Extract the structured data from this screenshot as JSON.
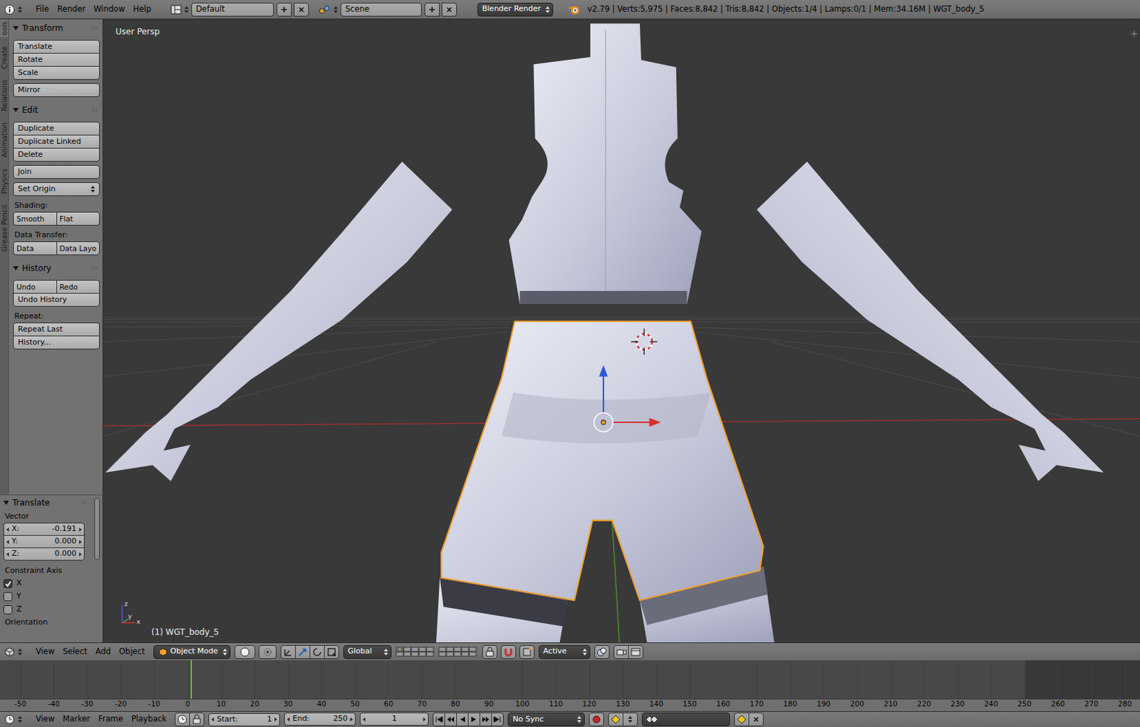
{
  "topbar": {
    "menus": [
      "File",
      "Render",
      "Window",
      "Help"
    ],
    "layout": "Default",
    "scene": "Scene",
    "engine": "Blender Render",
    "stats": "v2.79 | Verts:5,975 | Faces:8,842 | Tris:8,842 | Objects:1/4 | Lamps:0/1 | Mem:34.16M | WGT_body_5"
  },
  "tool_tabs": [
    {
      "label": "ools",
      "selected": true
    },
    {
      "label": "Create",
      "selected": false
    },
    {
      "label": "Relations",
      "selected": false
    },
    {
      "label": "Animation",
      "selected": false
    },
    {
      "label": "Physics",
      "selected": false
    },
    {
      "label": "Grease Pencil",
      "selected": false
    }
  ],
  "tool_panels": [
    {
      "title": "Transform",
      "expanded": true,
      "groups": [
        [
          {
            "kind": "button",
            "labels": [
              "Translate"
            ]
          },
          {
            "kind": "button",
            "labels": [
              "Rotate"
            ]
          },
          {
            "kind": "button",
            "labels": [
              "Scale"
            ]
          }
        ],
        [
          {
            "kind": "button",
            "labels": [
              "Mirror"
            ]
          }
        ]
      ]
    },
    {
      "title": "Edit",
      "expanded": true,
      "groups": [
        [
          {
            "kind": "button",
            "labels": [
              "Duplicate"
            ]
          },
          {
            "kind": "button",
            "labels": [
              "Duplicate Linked"
            ]
          },
          {
            "kind": "button",
            "labels": [
              "Delete"
            ]
          }
        ],
        [
          {
            "kind": "button",
            "labels": [
              "Join"
            ]
          }
        ],
        [
          {
            "kind": "menu",
            "labels": [
              "Set Origin"
            ]
          }
        ],
        [
          {
            "kind": "label",
            "labels": [
              "Shading:"
            ]
          },
          {
            "kind": "pair",
            "labels": [
              "Smooth",
              "Flat"
            ]
          }
        ],
        [
          {
            "kind": "label",
            "labels": [
              "Data Transfer:"
            ]
          },
          {
            "kind": "pair",
            "labels": [
              "Data",
              "Data Layo"
            ]
          }
        ]
      ]
    },
    {
      "title": "History",
      "expanded": true,
      "groups": [
        [
          {
            "kind": "pair",
            "labels": [
              "Undo",
              "Redo"
            ]
          },
          {
            "kind": "button",
            "labels": [
              "Undo History"
            ]
          }
        ],
        [
          {
            "kind": "label",
            "labels": [
              "Repeat:"
            ]
          },
          {
            "kind": "button",
            "labels": [
              "Repeat Last"
            ]
          },
          {
            "kind": "button",
            "labels": [
              "History..."
            ]
          }
        ]
      ]
    }
  ],
  "operator_panel": {
    "title": "Translate",
    "expanded": true,
    "vector_label": "Vector",
    "fields": [
      {
        "label": "X:",
        "value": "-0.191"
      },
      {
        "label": "Y:",
        "value": "0.000"
      },
      {
        "label": "Z:",
        "value": "0.000"
      }
    ],
    "constraint_label": "Constraint Axis",
    "axes": [
      {
        "label": "X",
        "checked": true
      },
      {
        "label": "Y",
        "checked": false
      },
      {
        "label": "Z",
        "checked": false
      }
    ],
    "next_label": "Orientation"
  },
  "viewport": {
    "view_label": "User Persp",
    "object_label": "(1) WGT_body_5",
    "gizmo_labels": [
      "z",
      "y",
      "x"
    ],
    "meshes": [
      {
        "kind": "torso",
        "selected": false
      },
      {
        "kind": "left-arm",
        "selected": false
      },
      {
        "kind": "right-arm",
        "selected": false
      },
      {
        "kind": "legs",
        "selected": false
      },
      {
        "kind": "hips",
        "selected": true
      }
    ]
  },
  "view_header": {
    "menus": [
      "View",
      "Select",
      "Add",
      "Object"
    ],
    "mode": "Object Mode",
    "orientation": "Global",
    "pivot": "Active"
  },
  "timeline": {
    "ticks": [
      "-50",
      "-40",
      "-30",
      "-20",
      "-10",
      "0",
      "10",
      "20",
      "30",
      "40",
      "50",
      "60",
      "70",
      "80",
      "90",
      "100",
      "110",
      "120",
      "130",
      "140",
      "150",
      "160",
      "170",
      "180",
      "190",
      "200",
      "210",
      "220",
      "230",
      "240",
      "250",
      "260",
      "270",
      "280"
    ]
  },
  "timeline_header": {
    "menus": [
      "View",
      "Marker",
      "Frame",
      "Playback"
    ],
    "start_label": "Start:",
    "start": "1",
    "end_label": "End:",
    "end": "250",
    "current": "1",
    "sync": "No Sync"
  }
}
